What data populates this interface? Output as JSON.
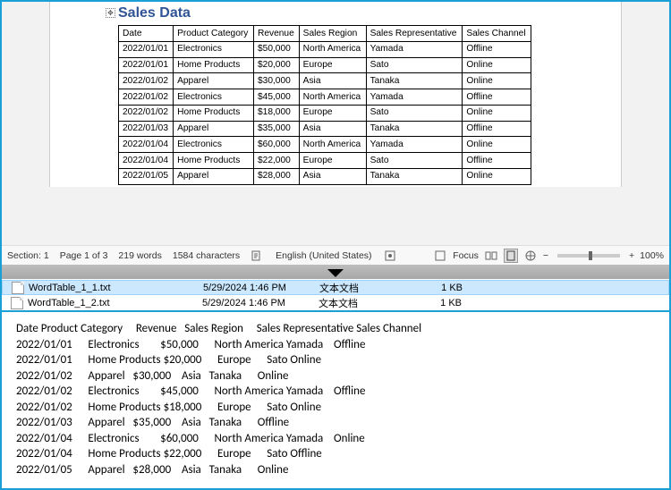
{
  "document": {
    "title": "Sales Data",
    "headers": [
      "Date",
      "Product Category",
      "Revenue",
      "Sales Region",
      "Sales Representative",
      "Sales Channel"
    ],
    "rows": [
      [
        "2022/01/01",
        "Electronics",
        "$50,000",
        "North America",
        "Yamada",
        "Offline"
      ],
      [
        "2022/01/01",
        "Home Products",
        "$20,000",
        "Europe",
        "Sato",
        "Online"
      ],
      [
        "2022/01/02",
        "Apparel",
        "$30,000",
        "Asia",
        "Tanaka",
        "Online"
      ],
      [
        "2022/01/02",
        "Electronics",
        "$45,000",
        "North America",
        "Yamada",
        "Offline"
      ],
      [
        "2022/01/02",
        "Home Products",
        "$18,000",
        "Europe",
        "Sato",
        "Online"
      ],
      [
        "2022/01/03",
        "Apparel",
        "$35,000",
        "Asia",
        "Tanaka",
        "Offline"
      ],
      [
        "2022/01/04",
        "Electronics",
        "$60,000",
        "North America",
        "Yamada",
        "Online"
      ],
      [
        "2022/01/04",
        "Home Products",
        "$22,000",
        "Europe",
        "Sato",
        "Offline"
      ],
      [
        "2022/01/05",
        "Apparel",
        "$28,000",
        "Asia",
        "Tanaka",
        "Online"
      ]
    ]
  },
  "statusbar": {
    "section": "Section: 1",
    "page": "Page 1 of 3",
    "words": "219 words",
    "chars": "1584 characters",
    "language": "English (United States)",
    "focus": "Focus",
    "zoom_minus": "−",
    "zoom_plus": "+",
    "zoom_pct": "100%"
  },
  "files": [
    {
      "name": "WordTable_1_1.txt",
      "date": "5/29/2024 1:46 PM",
      "type": "文本文档",
      "size": "1 KB"
    },
    {
      "name": "WordTable_1_2.txt",
      "date": "5/29/2024 1:46 PM",
      "type": "文本文档",
      "size": "1 KB"
    }
  ],
  "preview": {
    "header": "Date Product Category     Revenue   Sales Region     Sales Representative Sales Channel",
    "lines": [
      "2022/01/01      Electronics        $50,000      North America Yamada    Offline",
      "2022/01/01      Home Products $20,000      Europe      Sato Online",
      "2022/01/02      Apparel   $30,000    Asia   Tanaka      Online",
      "2022/01/02      Electronics        $45,000      North America Yamada    Offline",
      "2022/01/02      Home Products $18,000      Europe      Sato Online",
      "2022/01/03      Apparel   $35,000    Asia   Tanaka      Offline",
      "2022/01/04      Electronics        $60,000      North America Yamada    Online",
      "2022/01/04      Home Products $22,000      Europe      Sato Offline",
      "2022/01/05      Apparel   $28,000    Asia   Tanaka      Online"
    ]
  }
}
